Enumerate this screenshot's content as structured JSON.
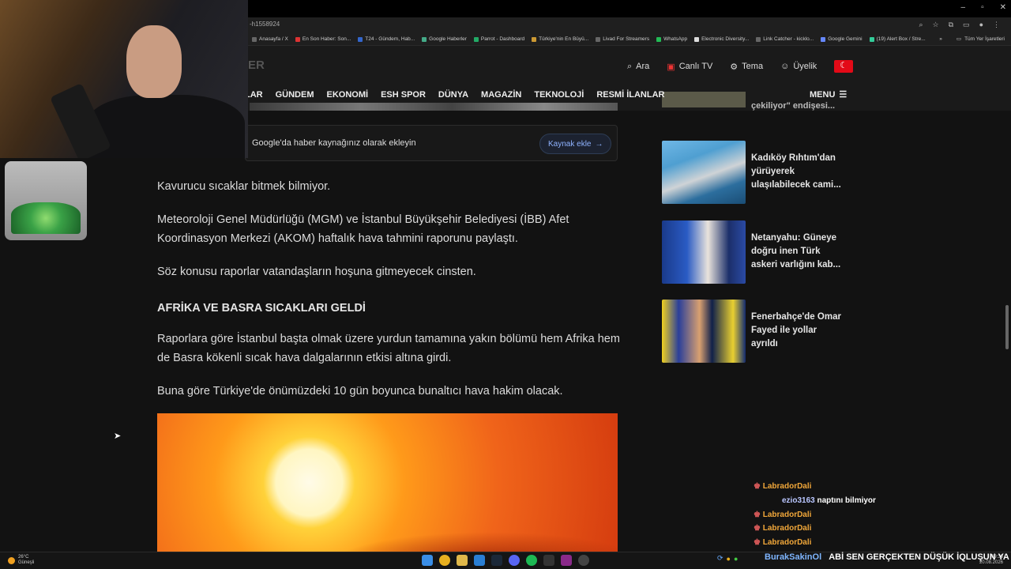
{
  "browser": {
    "url_fragment": "-h1558924",
    "bookmarks": [
      "Anasayfa / X",
      "En Son Haber: Son...",
      "T24 - Gündem, Hab...",
      "Google Haberler",
      "Parrot - Dashboard",
      "Türkiye'nin En Büyü...",
      "Livad For Streamers",
      "WhatsApp",
      "Electronic Diversity...",
      "Link Catcher - kicklo...",
      "Google Gemini",
      "(19) Alert Box / Stre..."
    ],
    "bookmarks_more": "»",
    "all_bookmarks": "Tüm Yer İşaretleri",
    "window_controls": [
      "–",
      "▫",
      "✕"
    ]
  },
  "header": {
    "logo_fragment": "ER",
    "search_label": "Ara",
    "live_tv_label": "Canlı TV",
    "theme_label": "Tema",
    "member_label": "Üyelik",
    "nav": [
      "LAR",
      "GÜNDEM",
      "EKONOMİ",
      "ESH SPOR",
      "DÜNYA",
      "MAGAZİN",
      "TEKNOLOJİ",
      "RESMİ İLANLAR"
    ],
    "menu_label": "MENU"
  },
  "article": {
    "google_prompt": "Google'da haber kaynağınız olarak ekleyin",
    "google_button": "Kaynak ekle",
    "p1": "Kavurucu sıcaklar bitmek bilmiyor.",
    "p2": "Meteoroloji Genel Müdürlüğü (MGM) ve İstanbul Büyükşehir Belediyesi (İBB) Afet Koordinasyon Merkezi (AKOM) haftalık hava tahmini raporunu paylaştı.",
    "p3": "Söz konusu raporlar vatandaşların hoşuna gitmeyecek cinsten.",
    "heading": "AFRİKA VE BASRA SICAKLARI GELDİ",
    "p4": "Raporlara göre İstanbul başta olmak üzere yurdun tamamına yakın bölümü hem Afrika hem de Basra kökenli sıcak hava dalgalarının etkisi altına girdi.",
    "p5": "Buna göre Türkiye'de önümüzdeki 10 gün boyunca bunaltıcı hava hakim olacak."
  },
  "sidebar": {
    "top_partial": "çekiliyor\" endişesi...",
    "items": [
      {
        "title": "Kadıköy Rıhtım'dan yürüyerek ulaşılabilecek cami..."
      },
      {
        "title": "Netanyahu: Güneye doğru inen Türk askeri varlığını kab..."
      },
      {
        "title": "Fenerbahçe'de Omar Fayed ile yollar ayrıldı"
      }
    ]
  },
  "chat": [
    {
      "user": "LabradorDali",
      "msg": ""
    },
    {
      "user": "ezio3163",
      "msg": "naptını bilmiyor"
    },
    {
      "user": "LabradorDali",
      "msg": ""
    },
    {
      "user": "LabradorDali",
      "msg": ""
    },
    {
      "user": "LabradorDali",
      "msg": ""
    }
  ],
  "taskbar": {
    "weather_temp": "26°C",
    "weather_desc": "Güneşli",
    "ticker_user": "BurakSakinOl",
    "ticker_msg": "ABİ SEN GERÇEKTEN DÜŞÜK İQLUŞUN YA",
    "time": "09:33",
    "date": "20.08.2026"
  },
  "colors": {
    "flag": "#e30a17",
    "accent_link": "#8fb3ff",
    "chat_user": "#f2a83a"
  }
}
